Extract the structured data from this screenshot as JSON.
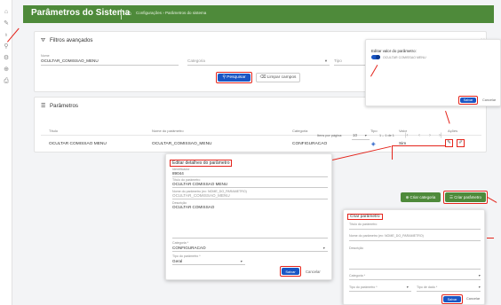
{
  "topbar": {
    "title": "Parâmetros do Sistema",
    "breadcrumb": "Configurações  ›  Parâmetros do sistema"
  },
  "filters": {
    "title": "Filtros avançados",
    "name_label": "Nome",
    "name_value": "OCULTAR_COMISSAO_MENU",
    "category_placeholder": "Categoria",
    "type_placeholder": "Tipo",
    "search_label": "Pesquisar",
    "clear_label": "Limpar campos"
  },
  "params": {
    "title": "Parâmetros",
    "headers": [
      "Título",
      "Nome do parâmetro",
      "Categoria",
      "Tipo",
      "Valor",
      "Ações"
    ],
    "row": {
      "title": "OCULTAR COMISSAO MENU",
      "name": "OCULTAR_COMISSAO_MENU",
      "category": "CONFIGURACAO",
      "value": "Sim"
    },
    "per_page_label": "Itens por página:",
    "per_page": "10",
    "range": "1 – 1 de 1"
  },
  "edit_value": {
    "title": "Editar valor do parâmetro:",
    "toggle_label": "OCULTAR COMISSAO MENU",
    "save": "Salvar",
    "cancel": "Cancelar"
  },
  "edit_details": {
    "title": "Editar detalhes do parâmetro",
    "id_label": "Identificador",
    "id_value": "89044",
    "title_label": "Título do parâmetro",
    "title_value": "OCULTAR COMISSAO MENU",
    "name_label": "Nome do parâmetro (ex: NOME_DO_PARAMETRO)",
    "name_value": "OCULTAR_COMISSAO_MENU",
    "desc_label": "Descrição",
    "desc_value": "OCULTAR COMISSAO",
    "category_label": "Categoria *",
    "category_value": "CONFIGURACAO",
    "type_label": "Tipo do parâmetro *",
    "type_value": "Geral",
    "save": "Salvar",
    "cancel": "Cancelar"
  },
  "actions": {
    "create_category": "Criar categoria",
    "create_param": "Criar parâmetro"
  },
  "create_param": {
    "title": "Criar parâmetro",
    "title_field": "Título do parâmetro",
    "name_field": "Nome do parâmetro (ex: NOME_DO_PARAMETRO)",
    "desc_field": "Descrição",
    "category_field": "Categoria *",
    "type_field": "Tipo do parâmetro *",
    "value_type_field": "Tipo de dado *",
    "save": "Salvar",
    "cancel": "Cancelar"
  },
  "icons": {
    "brand": "#4e8a3a",
    "accent": "#1a56c4",
    "annotation": "#e4241b"
  }
}
